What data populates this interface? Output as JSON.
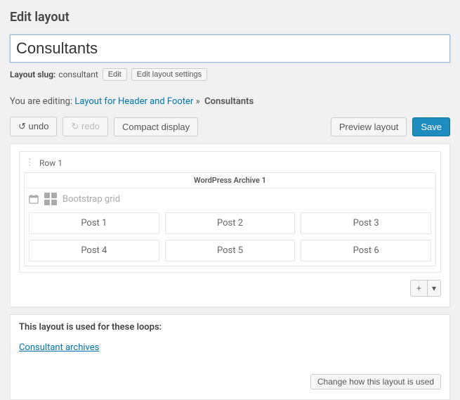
{
  "header": {
    "page_title": "Edit layout"
  },
  "title": {
    "value": "Consultants"
  },
  "slug": {
    "label": "Layout slug:",
    "value": "consultant",
    "edit_btn": "Edit",
    "settings_btn": "Edit layout settings"
  },
  "editing": {
    "prefix": "You are editing:",
    "link_text": "Layout for Header and Footer",
    "sep": "»",
    "current": "Consultants"
  },
  "toolbar": {
    "undo": "undo",
    "redo": "redo",
    "compact": "Compact display",
    "preview": "Preview layout",
    "save": "Save"
  },
  "row": {
    "label": "Row 1"
  },
  "archive": {
    "title": "WordPress Archive 1",
    "grid_label": "Bootstrap grid",
    "posts": [
      "Post 1",
      "Post 2",
      "Post 3",
      "Post 4",
      "Post 5",
      "Post 6"
    ]
  },
  "loops": {
    "heading": "This layout is used for these loops:",
    "links": [
      "Consultant archives"
    ],
    "change_btn": "Change how this layout is used"
  }
}
